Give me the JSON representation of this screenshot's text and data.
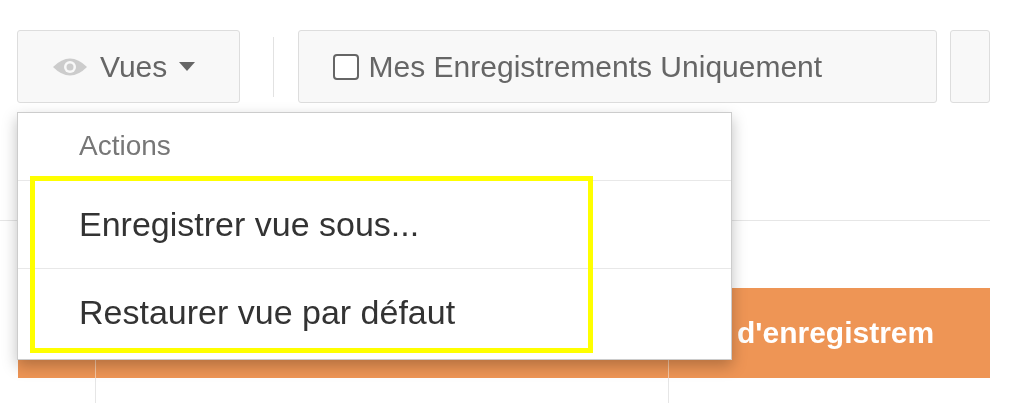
{
  "toolbar": {
    "views_button": {
      "label": "Vues"
    },
    "filter_toggle": {
      "label": "Mes Enregistrements Uniquement",
      "checked": false
    }
  },
  "views_menu": {
    "header": "Actions",
    "highlight_frame": true,
    "items": [
      {
        "label": "Enregistrer vue sous..."
      },
      {
        "label": "Restaurer vue par défaut"
      }
    ]
  },
  "table": {
    "header_text": "d'enregistrem"
  }
}
